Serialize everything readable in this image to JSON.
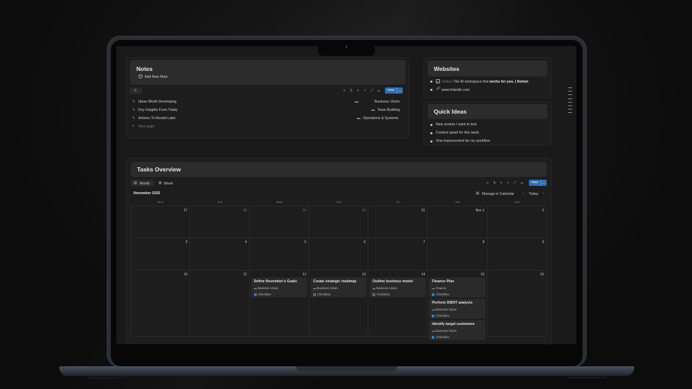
{
  "notes": {
    "title": "Notes",
    "add_label": "Add New Note",
    "items": [
      {
        "title": "Ideas Worth Developing",
        "tag": "Business Vision"
      },
      {
        "title": "Key Insights From Today",
        "tag": "Team Building"
      },
      {
        "title": "Actions To Revisit Later",
        "tag": "Operations & Systems"
      }
    ],
    "new_page_label": "New page",
    "new_label": "New"
  },
  "websites": {
    "title": "Websites",
    "links": [
      {
        "icon": "notion-icon",
        "site": "Notion",
        "desc_before": "The AI workspace that ",
        "desc_bold": "works for you. | Notion"
      },
      {
        "icon": "link-icon",
        "site": "",
        "desc_before": "www.linkedin.com",
        "desc_bold": ""
      }
    ]
  },
  "quick_ideas": {
    "title": "Quick Ideas",
    "items": [
      "New system I want to test",
      "Content spark for this week",
      "One improvement for my workflow"
    ]
  },
  "tasks": {
    "title": "Tasks Overview",
    "view_tabs": [
      "Month",
      "Week"
    ],
    "new_label": "New",
    "month_label": "November 2025",
    "manage_label": "Manage in Calendar",
    "today_label": "Today",
    "weekdays": [
      "Mon",
      "Tue",
      "Wed",
      "Thu",
      "Fri",
      "Sat",
      "Sun"
    ],
    "weeks": [
      [
        "27",
        "28",
        "29",
        "30",
        "31",
        "Nov 1",
        "2"
      ],
      [
        "3",
        "4",
        "5",
        "6",
        "7",
        "8",
        "9"
      ],
      [
        "10",
        "11",
        "12",
        "13",
        "14",
        "15",
        "16"
      ]
    ],
    "dim_days": [
      "28",
      "29",
      "30"
    ],
    "events": [
      {
        "col": 2,
        "slot": 0,
        "title": "Define November's Goals",
        "tag": "Business Vision",
        "done": true
      },
      {
        "col": 3,
        "slot": 0,
        "title": "Create strategic roadmap",
        "tag": "Business Vision",
        "done": false
      },
      {
        "col": 4,
        "slot": 0,
        "title": "Outline business model",
        "tag": "Business Vision",
        "done": false
      },
      {
        "col": 5,
        "slot": 0,
        "title": "Finance Plan",
        "tag": "Finance",
        "done": true
      },
      {
        "col": 5,
        "slot": 1,
        "title": "Perform SWOT analysis",
        "tag": "Business Vision",
        "done": true
      },
      {
        "col": 5,
        "slot": 2,
        "title": "Identify target customers",
        "tag": "Business Vision",
        "done": true
      }
    ],
    "checkbox_label": "Checkbox"
  }
}
